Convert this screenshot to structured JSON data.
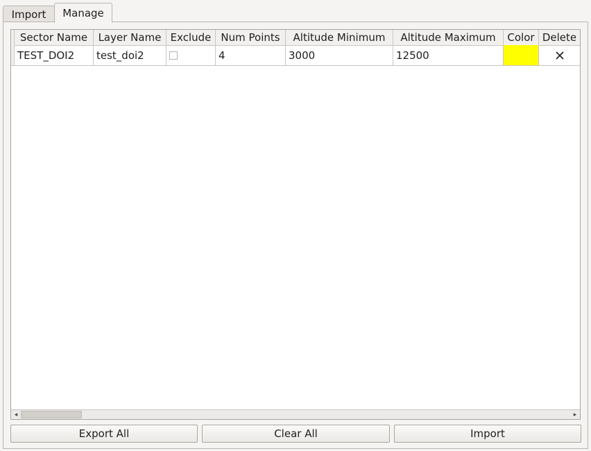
{
  "tabs": [
    {
      "label": "Import",
      "active": false
    },
    {
      "label": "Manage",
      "active": true
    }
  ],
  "table": {
    "columns": [
      "Sector Name",
      "Layer Name",
      "Exclude",
      "Num Points",
      "Altitude Minimum",
      "Altitude Maximum",
      "Color",
      "Delete"
    ],
    "rows": [
      {
        "sector_name": "TEST_DOI2",
        "layer_name": "test_doi2",
        "exclude": false,
        "num_points": "4",
        "altitude_minimum": "3000",
        "altitude_maximum": "12500",
        "color": "#ffff00",
        "delete_icon": "close-icon"
      }
    ]
  },
  "scrollbar": {
    "left_arrow": "◂",
    "right_arrow": "▸"
  },
  "buttons": {
    "export_all": "Export All",
    "clear_all": "Clear All",
    "import": "Import"
  }
}
